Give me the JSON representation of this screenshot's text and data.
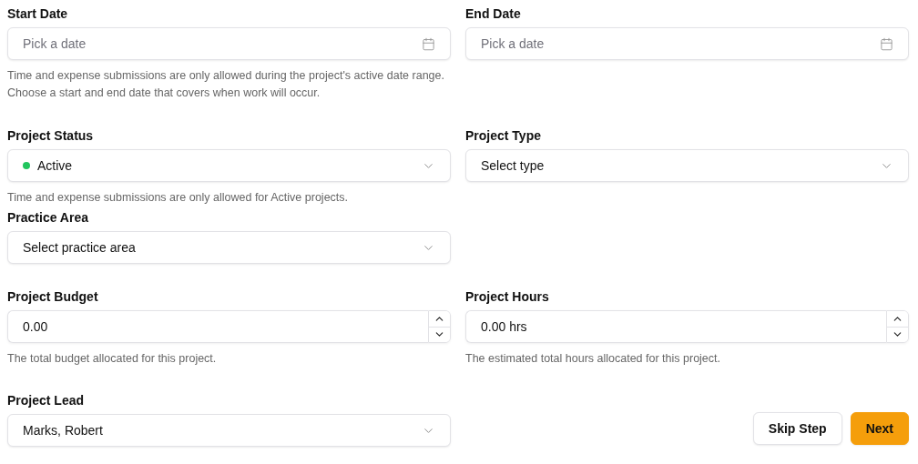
{
  "dates": [
    {
      "label": "Start Date",
      "placeholder": "Pick a date"
    },
    {
      "label": "End Date",
      "placeholder": "Pick a date"
    }
  ],
  "date_hint": [
    "Time and expense submissions are only allowed during the project's active date range.",
    "Choose a start and end date that covers when work will occur."
  ],
  "project_status": {
    "label": "Project Status",
    "value": "Active",
    "color": "#22c55e"
  },
  "project_type": {
    "label": "Project Type",
    "value": "Select type"
  },
  "status_hint": "Time and expense submissions are only allowed for Active projects.",
  "practice_area": {
    "label": "Practice Area",
    "value": "Select practice area"
  },
  "numbers": [
    {
      "label": "Project Budget",
      "value": "0.00",
      "hint": "The total budget allocated for this project."
    },
    {
      "label": "Project Hours",
      "value": "0.00 hrs",
      "hint": "The estimated total hours allocated for this project."
    }
  ],
  "project_lead": {
    "label": "Project Lead",
    "value": "Marks, Robert"
  },
  "buttons": [
    {
      "label": "Skip Step",
      "kind": "secondary"
    },
    {
      "label": "Next",
      "kind": "primary"
    }
  ]
}
